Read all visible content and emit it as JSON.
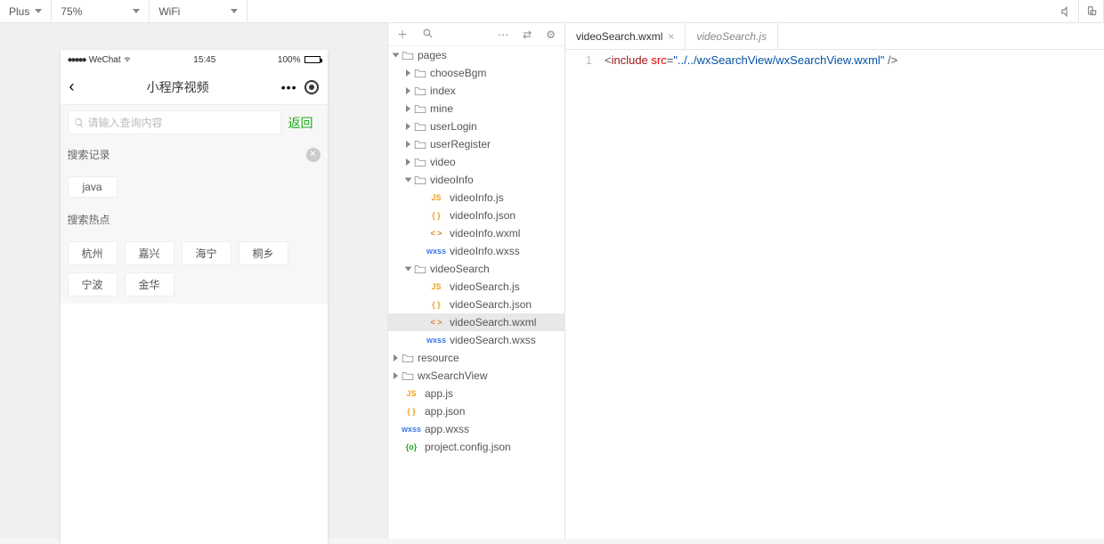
{
  "topbar": {
    "device": "Plus",
    "zoom": "75%",
    "network": "WiFi"
  },
  "sim": {
    "carrier": "WeChat",
    "time": "15:45",
    "battery": "100%",
    "page_title": "小程序视频",
    "search_placeholder": "请输入查询内容",
    "return_label": "返回",
    "history_label": "搜索记录",
    "history_items": [
      "java"
    ],
    "hot_label": "搜索热点",
    "hot_items": [
      "杭州",
      "嘉兴",
      "海宁",
      "桐乡",
      "宁波",
      "金华"
    ]
  },
  "tree": {
    "root": "pages",
    "folders_closed": [
      "chooseBgm",
      "index",
      "mine",
      "userLogin",
      "userRegister",
      "video"
    ],
    "videoInfo": {
      "name": "videoInfo",
      "files": [
        {
          "icon": "JS",
          "cls": "js",
          "name": "videoInfo.js"
        },
        {
          "icon": "{ }",
          "cls": "json",
          "name": "videoInfo.json"
        },
        {
          "icon": "< >",
          "cls": "wxml",
          "name": "videoInfo.wxml"
        },
        {
          "icon": "wxss",
          "cls": "wxss",
          "name": "videoInfo.wxss"
        }
      ]
    },
    "videoSearch": {
      "name": "videoSearch",
      "files": [
        {
          "icon": "JS",
          "cls": "js",
          "name": "videoSearch.js"
        },
        {
          "icon": "{ }",
          "cls": "json",
          "name": "videoSearch.json"
        },
        {
          "icon": "< >",
          "cls": "wxml",
          "name": "videoSearch.wxml",
          "selected": true
        },
        {
          "icon": "wxss",
          "cls": "wxss",
          "name": "videoSearch.wxss"
        }
      ]
    },
    "siblings": [
      "resource",
      "wxSearchView"
    ],
    "root_files": [
      {
        "icon": "JS",
        "cls": "js",
        "name": "app.js"
      },
      {
        "icon": "{ }",
        "cls": "json",
        "name": "app.json"
      },
      {
        "icon": "wxss",
        "cls": "wxss",
        "name": "app.wxss"
      },
      {
        "icon": "{o}",
        "cls": "cfg",
        "name": "project.config.json"
      }
    ]
  },
  "editor": {
    "tabs": [
      {
        "name": "videoSearch.wxml",
        "active": true,
        "closable": true
      },
      {
        "name": "videoSearch.js",
        "active": false,
        "closable": false,
        "italic": true
      }
    ],
    "line_no": "1",
    "code": {
      "tag": "include",
      "attr": "src",
      "val": "\"../../wxSearchView/wxSearchView.wxml\""
    }
  }
}
